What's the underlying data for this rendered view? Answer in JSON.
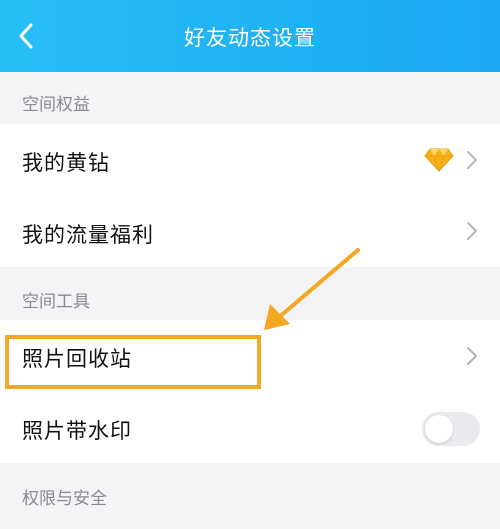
{
  "header": {
    "title": "好友动态设置",
    "back_icon": "chevron-left-icon"
  },
  "sections": {
    "space_rights": {
      "title": "空间权益",
      "items": [
        {
          "label": "我的黄钻",
          "icon": "yellow-diamond-icon"
        },
        {
          "label": "我的流量福利"
        }
      ]
    },
    "space_tools": {
      "title": "空间工具",
      "items": [
        {
          "label": "照片回收站"
        },
        {
          "label": "照片带水印",
          "toggle": false
        }
      ]
    },
    "permissions": {
      "title": "权限与安全"
    }
  },
  "colors": {
    "header": "#1aa8f4",
    "highlight": "#f5a623",
    "diamond": "#f7b21a"
  }
}
